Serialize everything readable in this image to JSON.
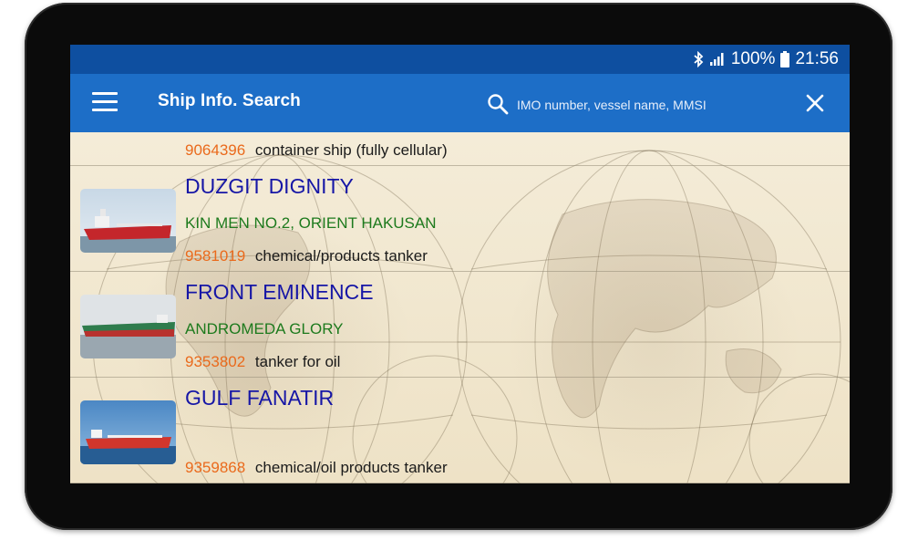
{
  "status_bar": {
    "battery": "100%",
    "time": "21:56"
  },
  "app_bar": {
    "title": "Ship Info. Search",
    "search_placeholder": "IMO number, vessel name, MMSI"
  },
  "results": [
    {
      "imo": "9064396",
      "type": "container ship (fully cellular)"
    },
    {
      "name": "DUZGIT DIGNITY",
      "alias": "KIN MEN NO.2, ORIENT HAKUSAN",
      "imo": "9581019",
      "type": "chemical/products tanker"
    },
    {
      "name": "FRONT EMINENCE",
      "alias": "ANDROMEDA GLORY",
      "imo": "9353802",
      "type": "tanker for oil"
    },
    {
      "name": "GULF FANATIR",
      "alias": "",
      "imo": "9359868",
      "type": "chemical/oil products tanker"
    }
  ],
  "icons": {
    "menu": "hamburger-icon",
    "search": "search-icon",
    "close": "close-icon",
    "bluetooth": "bluetooth-icon",
    "signal": "signal-icon",
    "battery": "battery-icon"
  },
  "colors": {
    "status_bar": "#0e4fa0",
    "app_bar": "#1d6ec7",
    "vessel_name": "#1616a6",
    "alias": "#1d7a1d",
    "imo": "#ea6a1c"
  }
}
